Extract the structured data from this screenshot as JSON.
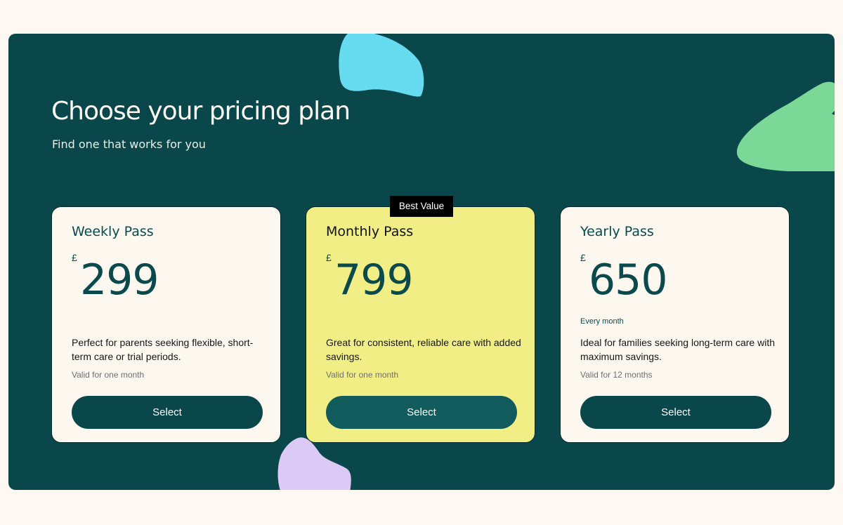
{
  "page": {
    "title": "Choose your pricing plan",
    "subtitle": "Find one that works for you"
  },
  "plans": [
    {
      "name": "Weekly Pass",
      "currency": "£",
      "price": "299",
      "period": "",
      "description": "Perfect for parents seeking flexible, short-term care or trial periods.",
      "validity": "Valid for one month",
      "button_label": "Select"
    },
    {
      "name": "Monthly Pass",
      "badge": "Best Value",
      "currency": "£",
      "price": "799",
      "period": "",
      "description": "Great for consistent, reliable care with added savings.",
      "validity": "Valid for one month",
      "button_label": "Select"
    },
    {
      "name": "Yearly Pass",
      "currency": "£",
      "price": "650",
      "period": "Every month",
      "description": "Ideal for families seeking long-term care with maximum savings.",
      "validity": "Valid for 12 months",
      "button_label": "Select"
    }
  ],
  "colors": {
    "background": "#fdf8f1",
    "panel": "#09474b",
    "card": "#fcf8f0",
    "featured_card": "#f1ee86",
    "button": "#09474b",
    "blob_blue": "#67dcf0",
    "blob_green": "#7cd897",
    "blob_purple": "#dccaf6"
  },
  "decorations": [
    "blue-blob",
    "green-blob",
    "purple-blob"
  ]
}
